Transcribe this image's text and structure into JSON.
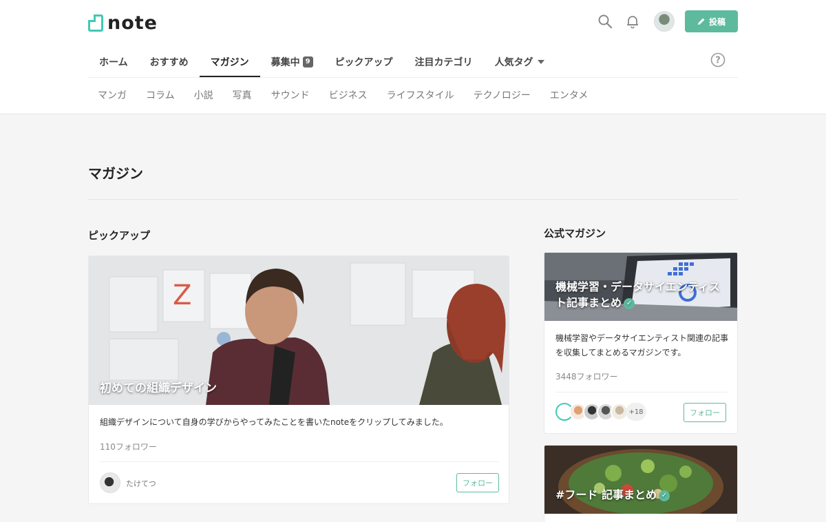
{
  "header": {
    "logo_text": "note",
    "post_label": "投稿"
  },
  "nav": {
    "tabs": [
      {
        "label": "ホーム"
      },
      {
        "label": "おすすめ"
      },
      {
        "label": "マガジン",
        "active": true
      },
      {
        "label": "募集中",
        "badge": "9"
      },
      {
        "label": "ピックアップ"
      },
      {
        "label": "注目カテゴリ"
      },
      {
        "label": "人気タグ"
      }
    ],
    "categories": [
      "マンガ",
      "コラム",
      "小説",
      "写真",
      "サウンド",
      "ビジネス",
      "ライフスタイル",
      "テクノロジー",
      "エンタメ"
    ]
  },
  "page": {
    "title": "マガジン"
  },
  "pickup": {
    "section_title": "ピックアップ",
    "card": {
      "title": "初めての組織デザイン",
      "description": "組織デザインについて自身の学びからやってみたことを書いたnoteをクリップしてみました。",
      "followers": "110フォロワー",
      "author": "たけてつ",
      "follow_label": "フォロー"
    }
  },
  "official": {
    "section_title": "公式マガジン",
    "cards": [
      {
        "title_line1": "機械学習・データサイエンティス",
        "title_line2": "ト記事まとめ",
        "description": "機械学習やデータサイエンティスト関連の記事を収集してまとめるマガジンです。",
        "followers": "3448フォロワー",
        "more_members": "+18",
        "follow_label": "フォロー"
      },
      {
        "title_line1": "#フード 記事まとめ"
      }
    ]
  },
  "colors": {
    "accent": "#5dba9d",
    "logo": "#41c9b4"
  }
}
